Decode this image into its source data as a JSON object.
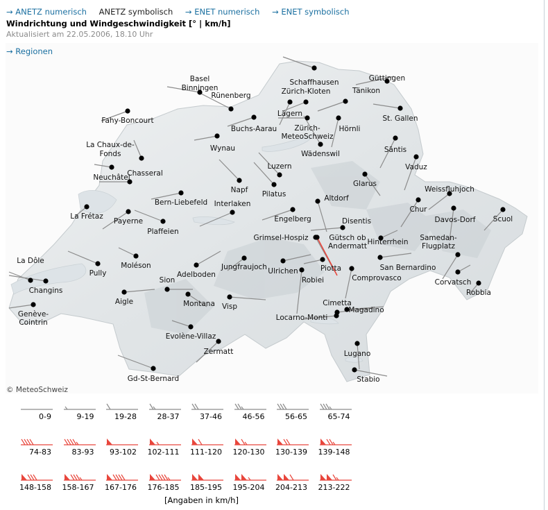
{
  "nav": {
    "links": [
      {
        "label": "→ ANETZ numerisch",
        "current": false
      },
      {
        "label": "ANETZ symbolisch",
        "current": true
      },
      {
        "label": "→ ENET numerisch",
        "current": false
      },
      {
        "label": "→ ENET symbolisch",
        "current": false
      }
    ]
  },
  "header": {
    "title": "Windrichtung und Windgeschwindigkeit [° | km/h]",
    "updated": "Aktualisiert am 22.05.2006, 18.10 Uhr",
    "regions_link": "→ Regionen"
  },
  "map": {
    "copyright": "© MeteoSchweiz",
    "stations": [
      {
        "name": "Güttingen"
      },
      {
        "name": "Schaffhausen"
      },
      {
        "name": "Rünenberg"
      },
      {
        "name": "Basel-Binningen"
      },
      {
        "name": "Zürich-Kloten"
      },
      {
        "name": "Tänikon"
      },
      {
        "name": "Lägern"
      },
      {
        "name": "St. Gallen"
      },
      {
        "name": "Fahy-Boncourt"
      },
      {
        "name": "Buchs-Aarau"
      },
      {
        "name": "Zürich-MeteoSchweiz"
      },
      {
        "name": "Hörnli"
      },
      {
        "name": "La Chaux-de-Fonds"
      },
      {
        "name": "Wynau"
      },
      {
        "name": "Wädenswil"
      },
      {
        "name": "Säntis"
      },
      {
        "name": "Chasseral"
      },
      {
        "name": "Luzern"
      },
      {
        "name": "Vaduz"
      },
      {
        "name": "Neuchâtel"
      },
      {
        "name": "Napf"
      },
      {
        "name": "Glarus"
      },
      {
        "name": "Pilatus"
      },
      {
        "name": "Weissfluhjoch"
      },
      {
        "name": "Bern-Liebefeld"
      },
      {
        "name": "Altdorf"
      },
      {
        "name": "Chur"
      },
      {
        "name": "La Frétaz"
      },
      {
        "name": "Payerne"
      },
      {
        "name": "Engelberg"
      },
      {
        "name": "Davos-Dorf"
      },
      {
        "name": "Scuol"
      },
      {
        "name": "Plaffeien"
      },
      {
        "name": "Interlaken"
      },
      {
        "name": "Disentis"
      },
      {
        "name": "Grimsel-Hospiz"
      },
      {
        "name": "Gütsch ob Andermatt"
      },
      {
        "name": "Hinterrhein"
      },
      {
        "name": "Samedan-Flugplatz"
      },
      {
        "name": "La Dôle"
      },
      {
        "name": "Jungfraujoch"
      },
      {
        "name": "Pully"
      },
      {
        "name": "Moléson"
      },
      {
        "name": "Ulrichen"
      },
      {
        "name": "Piotta"
      },
      {
        "name": "San Bernardino"
      },
      {
        "name": "Changins"
      },
      {
        "name": "Adelboden"
      },
      {
        "name": "Robiei"
      },
      {
        "name": "Comprovasco"
      },
      {
        "name": "Corvatsch"
      },
      {
        "name": "Robbia"
      },
      {
        "name": "Aigle"
      },
      {
        "name": "Sion"
      },
      {
        "name": "Montana"
      },
      {
        "name": "Visp"
      },
      {
        "name": "Cimetta"
      },
      {
        "name": "Genève-Cointrin"
      },
      {
        "name": "Magadino"
      },
      {
        "name": "Locarno-Monti"
      },
      {
        "name": "Evolène-Villaz"
      },
      {
        "name": "Zermatt"
      },
      {
        "name": "Lugano"
      },
      {
        "name": "Gd-St-Bernard"
      },
      {
        "name": "Stabio"
      }
    ]
  },
  "legend": {
    "row1": [
      {
        "range": "0-9",
        "barbs": 0,
        "flags": 0
      },
      {
        "range": "9-19",
        "barbs": 0.5,
        "flags": 0
      },
      {
        "range": "19-28",
        "barbs": 1,
        "flags": 0
      },
      {
        "range": "28-37",
        "barbs": 1.5,
        "flags": 0
      },
      {
        "range": "37-46",
        "barbs": 2,
        "flags": 0
      },
      {
        "range": "46-56",
        "barbs": 2.5,
        "flags": 0
      },
      {
        "range": "56-65",
        "barbs": 3,
        "flags": 0
      },
      {
        "range": "65-74",
        "barbs": 3.5,
        "flags": 0
      }
    ],
    "row2": [
      {
        "range": "74-83",
        "barbs": 4,
        "flags": 0
      },
      {
        "range": "83-93",
        "barbs": 4.5,
        "flags": 0
      },
      {
        "range": "93-102",
        "barbs": 0,
        "flags": 1
      },
      {
        "range": "102-111",
        "barbs": 0.5,
        "flags": 1
      },
      {
        "range": "111-120",
        "barbs": 1,
        "flags": 1
      },
      {
        "range": "120-130",
        "barbs": 1.5,
        "flags": 1
      },
      {
        "range": "130-139",
        "barbs": 2,
        "flags": 1
      },
      {
        "range": "139-148",
        "barbs": 2.5,
        "flags": 1
      }
    ],
    "row3": [
      {
        "range": "148-158",
        "barbs": 3,
        "flags": 1
      },
      {
        "range": "158-167",
        "barbs": 3.5,
        "flags": 1
      },
      {
        "range": "167-176",
        "barbs": 4,
        "flags": 1
      },
      {
        "range": "176-185",
        "barbs": 4.5,
        "flags": 1
      },
      {
        "range": "185-195",
        "barbs": 0,
        "flags": 2
      },
      {
        "range": "195-204",
        "barbs": 0.5,
        "flags": 2
      },
      {
        "range": "204-213",
        "barbs": 1,
        "flags": 2
      },
      {
        "range": "213-222",
        "barbs": 1.5,
        "flags": 2
      }
    ],
    "unit_note": "[Angaben in km/h]",
    "colors": {
      "barb": "#8c8c8c",
      "flag": "#e8463c"
    }
  }
}
